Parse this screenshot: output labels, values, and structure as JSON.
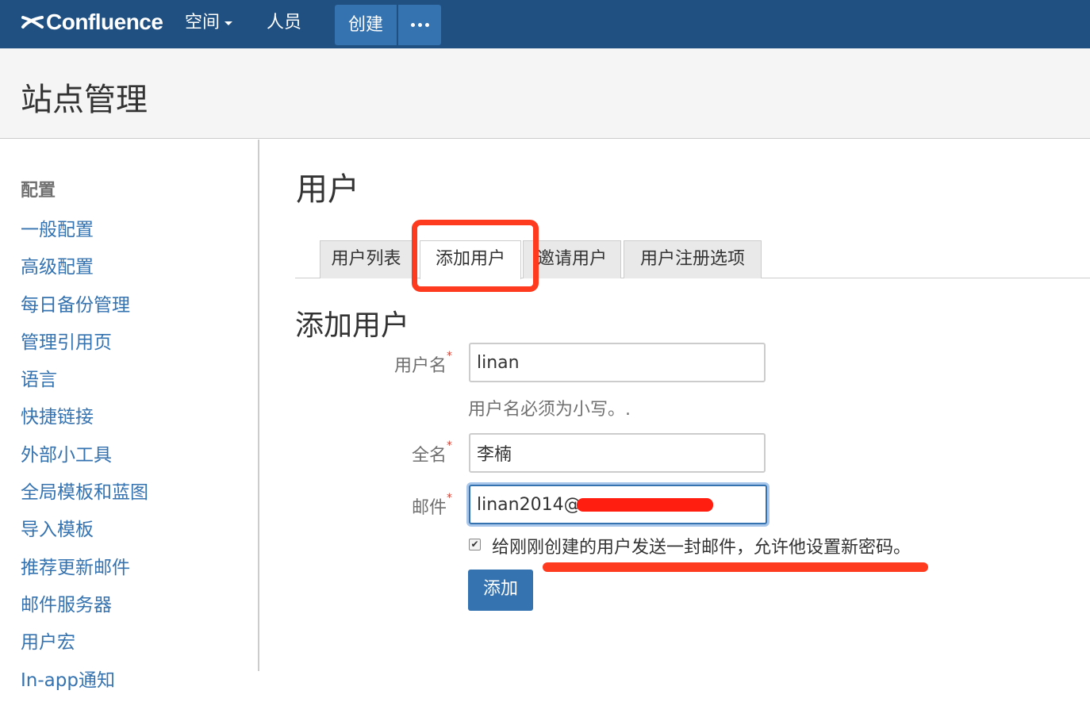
{
  "topnav": {
    "logo_text": "Confluence",
    "spaces_label": "空间",
    "people_label": "人员",
    "create_label": "创建",
    "more_icon": "ellipsis-icon"
  },
  "header": {
    "title": "站点管理"
  },
  "sidebar": {
    "heading": "配置",
    "items": [
      {
        "label": "一般配置"
      },
      {
        "label": "高级配置"
      },
      {
        "label": "每日备份管理"
      },
      {
        "label": "管理引用页"
      },
      {
        "label": "语言"
      },
      {
        "label": "快捷链接"
      },
      {
        "label": "外部小工具"
      },
      {
        "label": "全局模板和蓝图"
      },
      {
        "label": "导入模板"
      },
      {
        "label": "推荐更新邮件"
      },
      {
        "label": "邮件服务器"
      },
      {
        "label": "用户宏"
      },
      {
        "label": "In-app通知"
      }
    ]
  },
  "main": {
    "page_title": "用户",
    "tabs": [
      {
        "label": "用户列表"
      },
      {
        "label": "添加用户"
      },
      {
        "label": "邀请用户"
      },
      {
        "label": "用户注册选项"
      }
    ],
    "form": {
      "section_title": "添加用户",
      "username_label": "用户名",
      "username_value": "linan",
      "username_hint": "用户名必须为小写。.",
      "fullname_label": "全名",
      "fullname_value": "李楠",
      "email_label": "邮件",
      "email_value": "linan2014@",
      "required_mark": "*",
      "send_email_label": "给刚刚创建的用户发送一封邮件，允许他设置新密码。",
      "send_email_checked": true,
      "submit_label": "添加"
    }
  },
  "colors": {
    "nav_bg": "#205081",
    "accent": "#3572b0",
    "annotation": "#ff3b1f"
  }
}
